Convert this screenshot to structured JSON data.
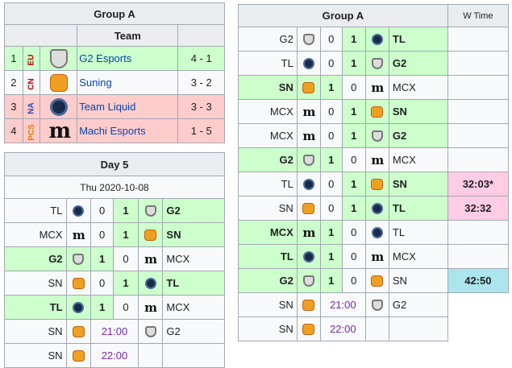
{
  "standings": {
    "title": "Group A",
    "team_header": "Team",
    "rows": [
      {
        "rank": "1",
        "region": "EU",
        "region_color": "#c00000",
        "team": "G2 Esports",
        "logo": "g2-logo",
        "record": "4 - 1"
      },
      {
        "rank": "2",
        "region": "CN",
        "region_color": "#c00000",
        "team": "Suning",
        "logo": "suning-logo",
        "record": "3 - 2"
      },
      {
        "rank": "3",
        "region": "NA",
        "region_color": "#1f4fbf",
        "team": "Team Liquid",
        "logo": "team-liquid-logo",
        "record": "3 - 3"
      },
      {
        "rank": "4",
        "region": "PCS",
        "region_color": "#e08000",
        "team": "Machi Esports",
        "logo": "machi-logo",
        "record": "1 - 5"
      }
    ]
  },
  "day": {
    "title": "Day 5",
    "date": "Thu 2020-10-08",
    "matches": [
      {
        "t1": "TL",
        "s1": "0",
        "s2": "1",
        "t2": "G2",
        "winner": 2
      },
      {
        "t1": "MCX",
        "s1": "0",
        "s2": "1",
        "t2": "SN",
        "winner": 2
      },
      {
        "t1": "G2",
        "s1": "1",
        "s2": "0",
        "t2": "MCX",
        "winner": 1
      },
      {
        "t1": "SN",
        "s1": "0",
        "s2": "1",
        "t2": "TL",
        "winner": 2
      },
      {
        "t1": "TL",
        "s1": "1",
        "s2": "0",
        "t2": "MCX",
        "winner": 1
      },
      {
        "t1": "SN",
        "time": "21:00",
        "t2": "G2"
      },
      {
        "t1": "SN",
        "time": "22:00",
        "t2": ""
      }
    ]
  },
  "group": {
    "title": "Group A",
    "wtime_header": "W Time",
    "matches": [
      {
        "t1": "G2",
        "s1": "0",
        "s2": "1",
        "t2": "TL",
        "winner": 2,
        "wt": ""
      },
      {
        "t1": "TL",
        "s1": "0",
        "s2": "1",
        "t2": "G2",
        "winner": 2,
        "wt": ""
      },
      {
        "t1": "SN",
        "s1": "1",
        "s2": "0",
        "t2": "MCX",
        "winner": 1,
        "wt": ""
      },
      {
        "t1": "MCX",
        "s1": "0",
        "s2": "1",
        "t2": "SN",
        "winner": 2,
        "wt": ""
      },
      {
        "t1": "MCX",
        "s1": "0",
        "s2": "1",
        "t2": "G2",
        "winner": 2,
        "wt": ""
      },
      {
        "t1": "G2",
        "s1": "1",
        "s2": "0",
        "t2": "MCX",
        "winner": 1,
        "wt": ""
      },
      {
        "t1": "TL",
        "s1": "0",
        "s2": "1",
        "t2": "SN",
        "winner": 2,
        "wt": "32:03*",
        "wt_color": "pink"
      },
      {
        "t1": "SN",
        "s1": "0",
        "s2": "1",
        "t2": "TL",
        "winner": 2,
        "wt": "32:32",
        "wt_color": "pink"
      },
      {
        "t1": "MCX",
        "s1": "1",
        "s2": "0",
        "t2": "TL",
        "winner": 1,
        "wt": ""
      },
      {
        "t1": "TL",
        "s1": "1",
        "s2": "0",
        "t2": "MCX",
        "winner": 1,
        "wt": ""
      },
      {
        "t1": "G2",
        "s1": "1",
        "s2": "0",
        "t2": "SN",
        "winner": 1,
        "wt": "42:50",
        "wt_color": "blue"
      },
      {
        "t1": "SN",
        "time": "21:00",
        "t2": "G2",
        "wt": ""
      },
      {
        "t1": "SN",
        "time": "22:00",
        "t2": "",
        "wt": ""
      }
    ]
  },
  "colors": {
    "win": "#ccffcc",
    "loss": "#ffcccc",
    "time": "#7928b3",
    "link": "#0645ad",
    "wt_pink": "#ffcce6",
    "wt_blue": "#ace5ee"
  },
  "icons": {
    "G2": "g2-icon",
    "TL": "team-liquid-icon",
    "SN": "suning-icon",
    "MCX": "machi-icon"
  }
}
